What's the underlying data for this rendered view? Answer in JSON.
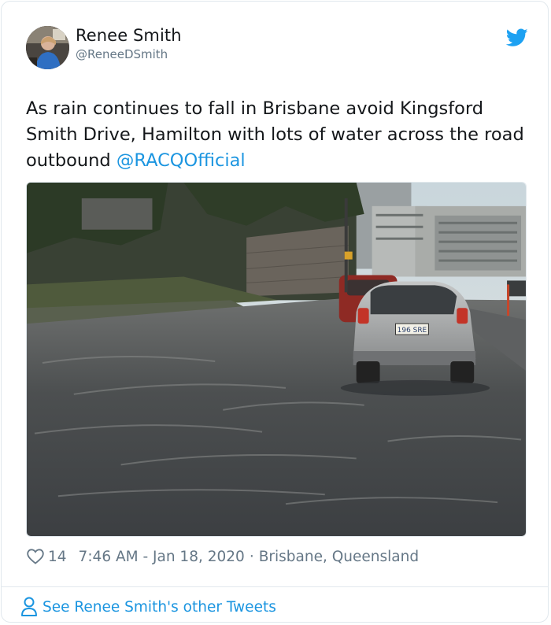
{
  "tweet": {
    "author_name": "Renee Smith",
    "author_handle": "@ReneeDSmith",
    "text_main": "As rain continues to fall in Brisbane avoid Kingsford Smith Drive, Hamilton with lots of water across the road outbound ",
    "text_mention": "@RACQOfficial",
    "like_count": "14",
    "time": "7:46 AM - Jan 18, 2020",
    "separator": "·",
    "location": "Brisbane, Queensland",
    "plate_text": "196 SRE"
  },
  "footer": {
    "label": "See Renee Smith's other Tweets"
  },
  "icons": {
    "brand": "twitter-bird-icon",
    "like": "heart-icon",
    "profile": "person-icon"
  },
  "colors": {
    "accent": "#1b95e0",
    "text": "#14171a",
    "muted": "#657786",
    "border": "#e1e8ed"
  }
}
